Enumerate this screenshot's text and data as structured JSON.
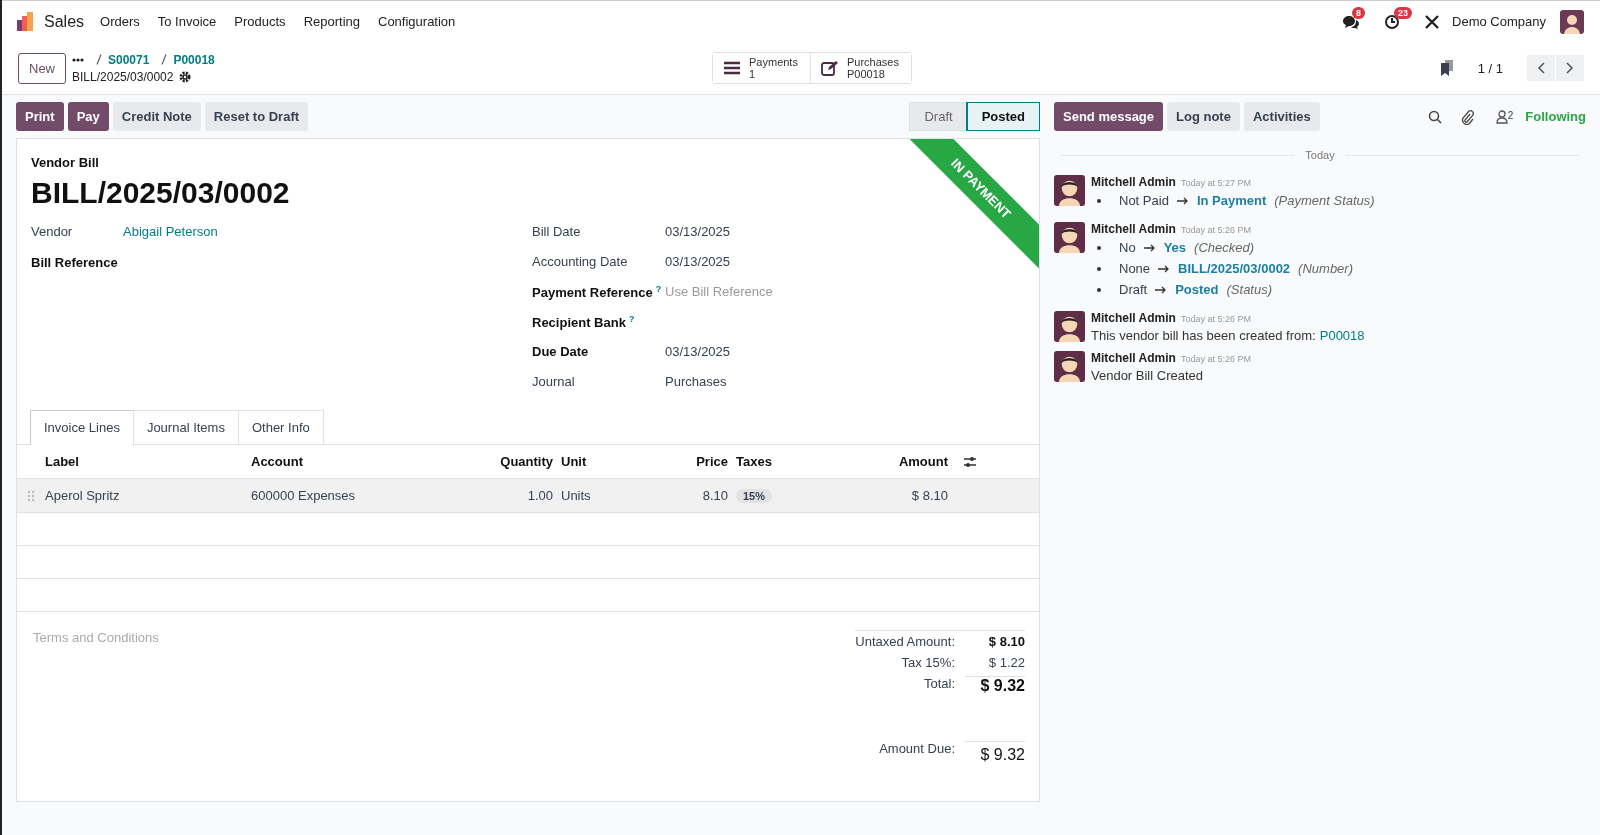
{
  "navbar": {
    "app_name": "Sales",
    "menu": [
      "Orders",
      "To Invoice",
      "Products",
      "Reporting",
      "Configuration"
    ],
    "messages_badge": "8",
    "activities_badge": "23",
    "company": "Demo Company"
  },
  "control_panel": {
    "new_button": "New",
    "breadcrumbs": [
      "S00071",
      "P00018"
    ],
    "record": "BILL/2025/03/0002",
    "smart_buttons": [
      {
        "kind": "list",
        "label": "Payments",
        "value": "1"
      },
      {
        "kind": "edit",
        "label": "Purchases",
        "value": "P00018"
      }
    ],
    "pager": "1 / 1"
  },
  "action_buttons": [
    {
      "label": "Print",
      "kind": "primary"
    },
    {
      "label": "Pay",
      "kind": "primary"
    },
    {
      "label": "Credit Note",
      "kind": "secondary"
    },
    {
      "label": "Reset to Draft",
      "kind": "secondary"
    }
  ],
  "statusbar": [
    {
      "label": "Draft",
      "selected": false
    },
    {
      "label": "Posted",
      "selected": true
    }
  ],
  "form": {
    "type_label": "Vendor Bill",
    "name": "BILL/2025/03/0002",
    "ribbon": "IN PAYMENT",
    "left_fields": [
      {
        "label": "Vendor",
        "bold": false,
        "kind": "link",
        "value": "Abigail Peterson"
      },
      {
        "label": "Bill Reference",
        "bold": true,
        "kind": "empty"
      }
    ],
    "right_fields": [
      {
        "label": "Bill Date",
        "bold": false,
        "kind": "text",
        "value": "03/13/2025"
      },
      {
        "label": "Accounting Date",
        "bold": false,
        "kind": "text",
        "value": "03/13/2025"
      },
      {
        "label": "Payment Reference",
        "bold": true,
        "help": "?",
        "kind": "placeholder",
        "placeholder": "Use Bill Reference"
      },
      {
        "label": "Recipient Bank",
        "bold": true,
        "help": "?",
        "kind": "empty"
      },
      {
        "label": "Due Date",
        "bold": true,
        "kind": "text",
        "value": "03/13/2025"
      },
      {
        "label": "Journal",
        "bold": false,
        "kind": "text",
        "value": "Purchases"
      }
    ],
    "tabs": [
      {
        "label": "Invoice Lines",
        "selected": true
      },
      {
        "label": "Journal Items",
        "selected": false
      },
      {
        "label": "Other Info",
        "selected": false
      }
    ],
    "table": {
      "columns": [
        "Label",
        "Account",
        "Quantity",
        "Unit",
        "Price",
        "Taxes",
        "Amount"
      ],
      "rows": [
        {
          "label": "Aperol Spritz",
          "account": "600000 Expenses",
          "quantity": "1.00",
          "unit": "Units",
          "price": "8.10",
          "taxes": "15%",
          "amount": "$ 8.10"
        }
      ]
    },
    "terms_placeholder": "Terms and Conditions",
    "totals": [
      {
        "kind": "subtotal",
        "label": "Untaxed Amount:",
        "value": "$ 8.10"
      },
      {
        "kind": "tax",
        "label": "Tax 15%:",
        "value": "$ 1.22"
      },
      {
        "kind": "total",
        "label": "Total:",
        "value": "$ 9.32"
      },
      {
        "kind": "due",
        "label": "Amount Due:",
        "value": "$ 9.32"
      }
    ]
  },
  "chatter": {
    "buttons": [
      {
        "label": "Send message",
        "kind": "primary"
      },
      {
        "label": "Log note",
        "kind": "secondary"
      },
      {
        "label": "Activities",
        "kind": "secondary"
      }
    ],
    "followers_count": "2",
    "follow_label": "Following",
    "date_separator": "Today",
    "messages": [
      {
        "kind": "tracking",
        "author": "Mitchell Admin",
        "time": "Today at 5:27 PM",
        "changes": [
          {
            "old": "Not Paid",
            "new": "In Payment",
            "field": "(Payment Status)"
          }
        ]
      },
      {
        "kind": "tracking",
        "author": "Mitchell Admin",
        "time": "Today at 5:26 PM",
        "changes": [
          {
            "old": "No",
            "new": "Yes",
            "field": "(Checked)"
          },
          {
            "old": "None",
            "new": "BILL/2025/03/0002",
            "field": "(Number)"
          },
          {
            "old": "Draft",
            "new": "Posted",
            "field": "(Status)"
          }
        ]
      },
      {
        "kind": "text",
        "author": "Mitchell Admin",
        "time": "Today at 5:26 PM",
        "text": "This vendor bill has been created from:",
        "link": "P00018"
      },
      {
        "kind": "text",
        "author": "Mitchell Admin",
        "time": "Today at 5:26 PM",
        "text": "Vendor Bill Created"
      }
    ]
  }
}
